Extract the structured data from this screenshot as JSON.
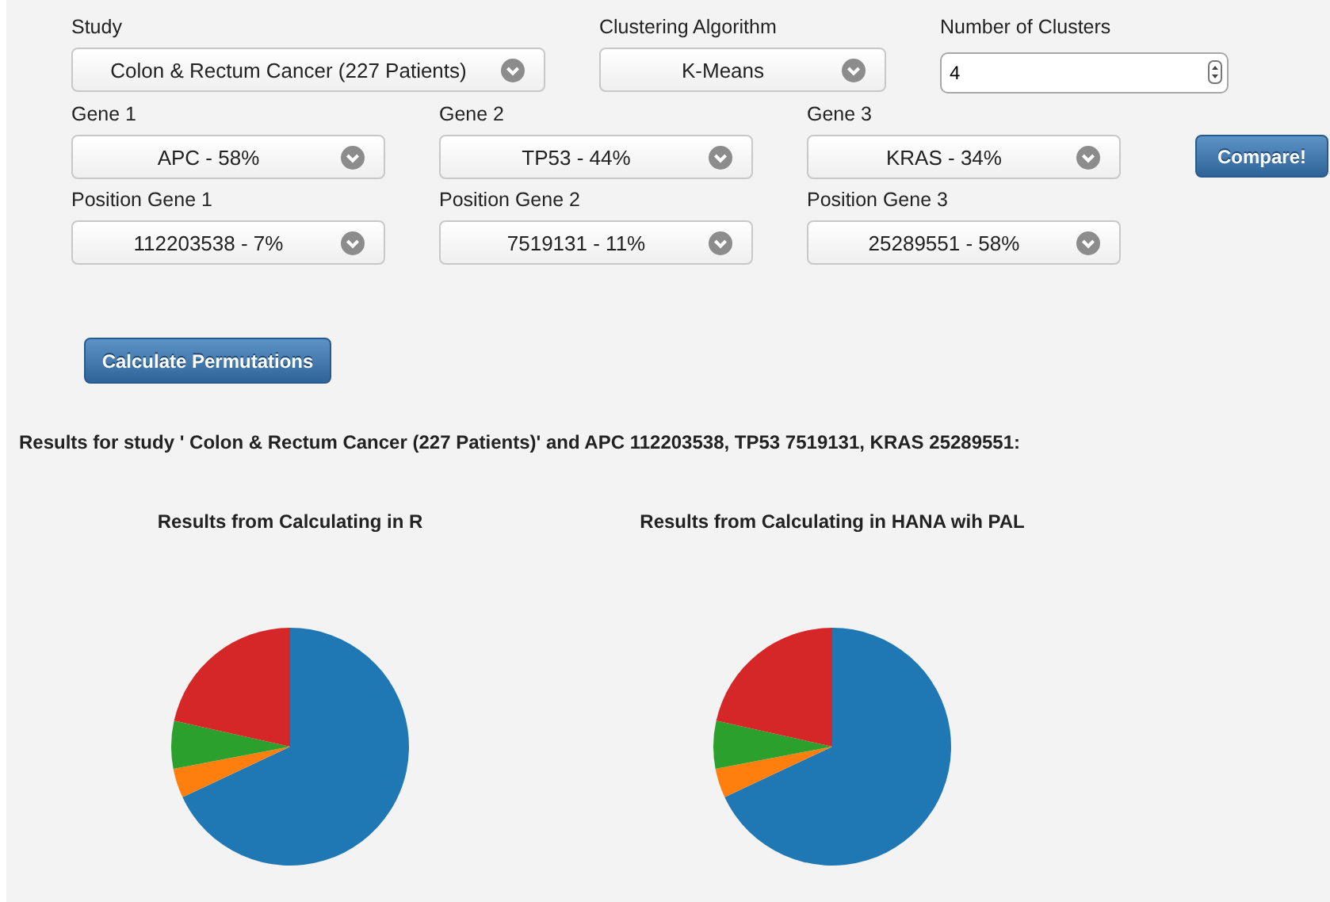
{
  "study": {
    "label": "Study",
    "value": "Colon & Rectum Cancer (227 Patients)"
  },
  "clustering_algorithm": {
    "label": "Clustering Algorithm",
    "value": "K-Means"
  },
  "number_of_clusters": {
    "label": "Number of Clusters",
    "value": "4"
  },
  "genes": [
    {
      "label": "Gene 1",
      "value": "APC - 58%"
    },
    {
      "label": "Gene 2",
      "value": "TP53 - 44%"
    },
    {
      "label": "Gene 3",
      "value": "KRAS - 34%"
    }
  ],
  "compare_button": "Compare!",
  "positions": [
    {
      "label": "Position Gene 1",
      "value": "112203538 - 7%"
    },
    {
      "label": "Position Gene 2",
      "value": "7519131 - 11%"
    },
    {
      "label": "Position Gene 3",
      "value": "25289551 - 58%"
    }
  ],
  "calculate_button": "Calculate Permutations",
  "results_heading": "Results for study ' Colon & Rectum Cancer (227 Patients)' and APC 112203538, TP53 7519131, KRAS 25289551:",
  "results": [
    {
      "title": "Results from Calculating in R",
      "kind": "picture"
    },
    {
      "title": "Results from Calculating in HANA wih PAL",
      "kind": "picture"
    }
  ]
}
